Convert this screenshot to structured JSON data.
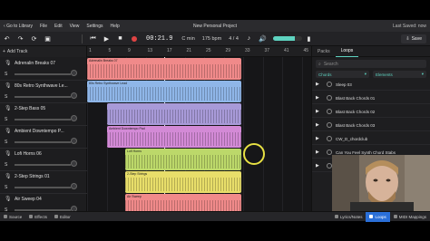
{
  "menu": {
    "back": "Go to Library",
    "items": [
      "File",
      "Edit",
      "View",
      "Settings",
      "Help"
    ],
    "project_title": "New Personal Project",
    "last_saved": "Last Saved: now"
  },
  "toolbar": {
    "time": "00:21.9",
    "key": "C min",
    "tempo": "175 bpm",
    "signature": "4 / 4",
    "volume_fraction": 0.75,
    "save_label": "Save"
  },
  "tracks_header": {
    "add_track": "Add Track"
  },
  "ruler": {
    "marks": [
      "1",
      "5",
      "9",
      "13",
      "17",
      "21",
      "25",
      "29",
      "33",
      "37",
      "41",
      "45"
    ]
  },
  "tracks": [
    {
      "name": "Adrenalin Breaks 07",
      "s": "S"
    },
    {
      "name": "80s Retro Synthwave Le...",
      "s": "S"
    },
    {
      "name": "2-Step Bass 05",
      "s": "S"
    },
    {
      "name": "Ambient Downtempo P...",
      "s": "S"
    },
    {
      "name": "Lofi Horns 06",
      "s": "S"
    },
    {
      "name": "2-Step Strings 01",
      "s": "S"
    },
    {
      "name": "Air Sweep 04",
      "s": "S"
    }
  ],
  "clips": [
    {
      "label": "Adrenalin Breaks 07",
      "color": "#f08a8a"
    },
    {
      "label": "80s Retro Synthwave Lead",
      "color": "#8fb6e8"
    },
    {
      "label": "",
      "color": "#a89ad8"
    },
    {
      "label": "Ambient Downtempo Pad",
      "color": "#d38ad6"
    },
    {
      "label": "Lofi Horns",
      "color": "#bcd86a"
    },
    {
      "label": "2-Step Strings",
      "color": "#e8de6a"
    },
    {
      "label": "Air Sweep",
      "color": "#f08a8a"
    }
  ],
  "panel": {
    "tabs": [
      "Packs",
      "Loops"
    ],
    "search_placeholder": "Search",
    "filter1": "Chords",
    "filter2": "Elements",
    "loops": [
      "Sleep 03",
      "Blast Back Chords 01",
      "Blast Back Chords 02",
      "Blast Back Chords 03",
      "CW_D_chordclub",
      "Can You Feel Synth Chord Stabs",
      "Candy Wrap Chord Progression"
    ]
  },
  "bottombar": {
    "source": "Source",
    "effects": "Effects",
    "editor": "Editor",
    "lyrics": "Lyrics/Notes",
    "loops": "Loops",
    "midi": "MIDI Mappings"
  }
}
